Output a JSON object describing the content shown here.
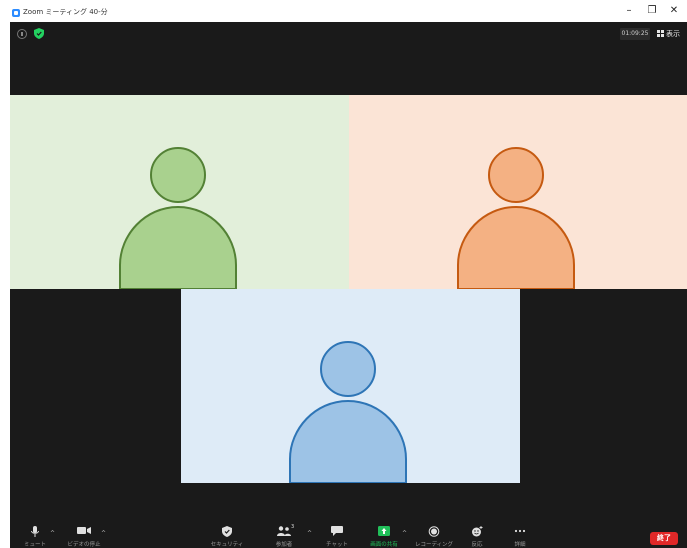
{
  "window": {
    "title": "Zoom ミーティング 40-分",
    "minimize": "–",
    "restore": "❐",
    "close": "✕"
  },
  "header": {
    "timer": "01:09:25",
    "view_label": "表示"
  },
  "participants": [
    {
      "color": "#a9d18e",
      "outline": "#538135",
      "background": "#e2efda"
    },
    {
      "color": "#f4b183",
      "outline": "#c55a11",
      "background": "#fbe4d6"
    },
    {
      "color": "#9dc3e6",
      "outline": "#2e75b6",
      "background": "#deebf7"
    }
  ],
  "toolbar": {
    "mute_label": "ミュート",
    "video_label": "ビデオの停止",
    "security_label": "セキュリティ",
    "participants_label": "参加者",
    "participants_count": "3",
    "chat_label": "チャット",
    "share_label": "画面の共有",
    "record_label": "レコーディング",
    "reactions_label": "反応",
    "more_label": "詳細",
    "end_label": "終了"
  },
  "colors": {
    "share_green": "#21c05a",
    "end_red": "#e02828",
    "security_green": "#23d160"
  }
}
